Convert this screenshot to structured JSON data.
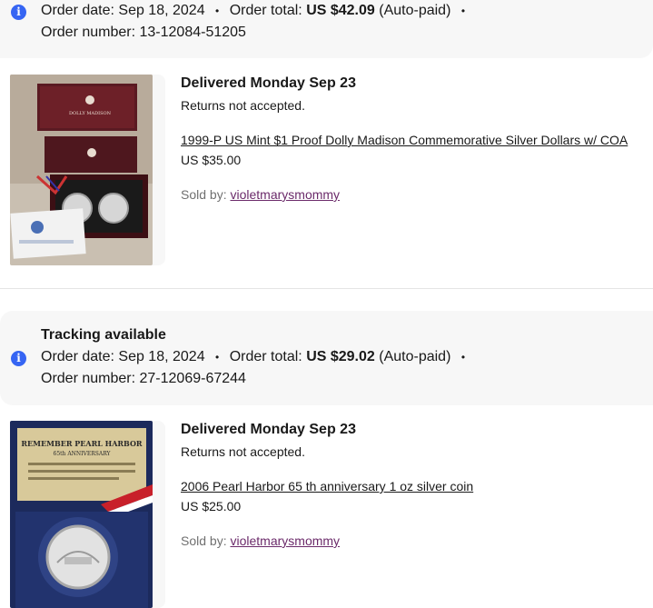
{
  "orders": [
    {
      "tracking": "",
      "order_date_label": "Order date:",
      "order_date": "Sep 18, 2024",
      "order_total_label": "Order total:",
      "order_total": "US $42.09",
      "paid_status": "(Auto-paid)",
      "order_number_label": "Order number:",
      "order_number": "13-12084-51205",
      "delivery": "Delivered Monday Sep 23",
      "returns": "Returns not accepted.",
      "item_title": "1999-P US Mint $1 Proof Dolly Madison Commemorative Silver Dollars w/ COA",
      "item_price": "US $35.00",
      "sold_by_label": "Sold by:",
      "seller": "violetmarysmommy"
    },
    {
      "tracking": "Tracking available",
      "order_date_label": "Order date:",
      "order_date": "Sep 18, 2024",
      "order_total_label": "Order total:",
      "order_total": "US $29.02",
      "paid_status": "(Auto-paid)",
      "order_number_label": "Order number:",
      "order_number": "27-12069-67244",
      "delivery": "Delivered Monday Sep 23",
      "returns": "Returns not accepted.",
      "item_title": "2006 Pearl Harbor 65 th anniversary 1 oz silver coin",
      "item_price": "US $25.00",
      "sold_by_label": "Sold by:",
      "seller": "violetmarysmommy"
    }
  ],
  "images": {
    "dolly_madison_box_label": "DOLLY MADISON",
    "pearl_harbor_label_line1": "REMEMBER PEARL HARBOR",
    "pearl_harbor_label_line2": "65th ANNIVERSARY"
  },
  "colors": {
    "header_bg": "#f7f7f7",
    "info_icon": "#3665f3",
    "seller_link": "#6b2a6a"
  }
}
